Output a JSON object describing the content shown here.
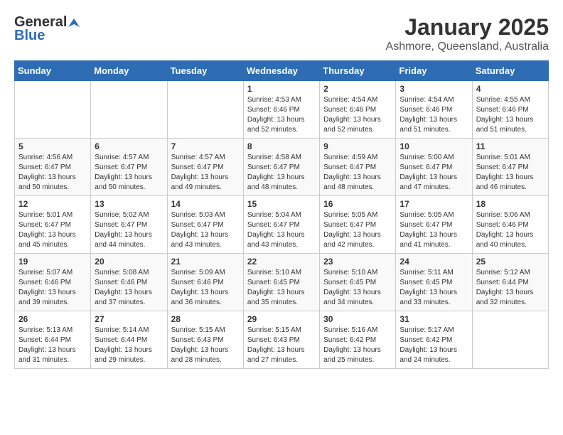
{
  "header": {
    "logo_general": "General",
    "logo_blue": "Blue",
    "title": "January 2025",
    "subtitle": "Ashmore, Queensland, Australia"
  },
  "weekdays": [
    "Sunday",
    "Monday",
    "Tuesday",
    "Wednesday",
    "Thursday",
    "Friday",
    "Saturday"
  ],
  "weeks": [
    [
      {
        "day": "",
        "info": ""
      },
      {
        "day": "",
        "info": ""
      },
      {
        "day": "",
        "info": ""
      },
      {
        "day": "1",
        "info": "Sunrise: 4:53 AM\nSunset: 6:46 PM\nDaylight: 13 hours and 52 minutes."
      },
      {
        "day": "2",
        "info": "Sunrise: 4:54 AM\nSunset: 6:46 PM\nDaylight: 13 hours and 52 minutes."
      },
      {
        "day": "3",
        "info": "Sunrise: 4:54 AM\nSunset: 6:46 PM\nDaylight: 13 hours and 51 minutes."
      },
      {
        "day": "4",
        "info": "Sunrise: 4:55 AM\nSunset: 6:46 PM\nDaylight: 13 hours and 51 minutes."
      }
    ],
    [
      {
        "day": "5",
        "info": "Sunrise: 4:56 AM\nSunset: 6:47 PM\nDaylight: 13 hours and 50 minutes."
      },
      {
        "day": "6",
        "info": "Sunrise: 4:57 AM\nSunset: 6:47 PM\nDaylight: 13 hours and 50 minutes."
      },
      {
        "day": "7",
        "info": "Sunrise: 4:57 AM\nSunset: 6:47 PM\nDaylight: 13 hours and 49 minutes."
      },
      {
        "day": "8",
        "info": "Sunrise: 4:58 AM\nSunset: 6:47 PM\nDaylight: 13 hours and 48 minutes."
      },
      {
        "day": "9",
        "info": "Sunrise: 4:59 AM\nSunset: 6:47 PM\nDaylight: 13 hours and 48 minutes."
      },
      {
        "day": "10",
        "info": "Sunrise: 5:00 AM\nSunset: 6:47 PM\nDaylight: 13 hours and 47 minutes."
      },
      {
        "day": "11",
        "info": "Sunrise: 5:01 AM\nSunset: 6:47 PM\nDaylight: 13 hours and 46 minutes."
      }
    ],
    [
      {
        "day": "12",
        "info": "Sunrise: 5:01 AM\nSunset: 6:47 PM\nDaylight: 13 hours and 45 minutes."
      },
      {
        "day": "13",
        "info": "Sunrise: 5:02 AM\nSunset: 6:47 PM\nDaylight: 13 hours and 44 minutes."
      },
      {
        "day": "14",
        "info": "Sunrise: 5:03 AM\nSunset: 6:47 PM\nDaylight: 13 hours and 43 minutes."
      },
      {
        "day": "15",
        "info": "Sunrise: 5:04 AM\nSunset: 6:47 PM\nDaylight: 13 hours and 43 minutes."
      },
      {
        "day": "16",
        "info": "Sunrise: 5:05 AM\nSunset: 6:47 PM\nDaylight: 13 hours and 42 minutes."
      },
      {
        "day": "17",
        "info": "Sunrise: 5:05 AM\nSunset: 6:47 PM\nDaylight: 13 hours and 41 minutes."
      },
      {
        "day": "18",
        "info": "Sunrise: 5:06 AM\nSunset: 6:46 PM\nDaylight: 13 hours and 40 minutes."
      }
    ],
    [
      {
        "day": "19",
        "info": "Sunrise: 5:07 AM\nSunset: 6:46 PM\nDaylight: 13 hours and 39 minutes."
      },
      {
        "day": "20",
        "info": "Sunrise: 5:08 AM\nSunset: 6:46 PM\nDaylight: 13 hours and 37 minutes."
      },
      {
        "day": "21",
        "info": "Sunrise: 5:09 AM\nSunset: 6:46 PM\nDaylight: 13 hours and 36 minutes."
      },
      {
        "day": "22",
        "info": "Sunrise: 5:10 AM\nSunset: 6:45 PM\nDaylight: 13 hours and 35 minutes."
      },
      {
        "day": "23",
        "info": "Sunrise: 5:10 AM\nSunset: 6:45 PM\nDaylight: 13 hours and 34 minutes."
      },
      {
        "day": "24",
        "info": "Sunrise: 5:11 AM\nSunset: 6:45 PM\nDaylight: 13 hours and 33 minutes."
      },
      {
        "day": "25",
        "info": "Sunrise: 5:12 AM\nSunset: 6:44 PM\nDaylight: 13 hours and 32 minutes."
      }
    ],
    [
      {
        "day": "26",
        "info": "Sunrise: 5:13 AM\nSunset: 6:44 PM\nDaylight: 13 hours and 31 minutes."
      },
      {
        "day": "27",
        "info": "Sunrise: 5:14 AM\nSunset: 6:44 PM\nDaylight: 13 hours and 29 minutes."
      },
      {
        "day": "28",
        "info": "Sunrise: 5:15 AM\nSunset: 6:43 PM\nDaylight: 13 hours and 28 minutes."
      },
      {
        "day": "29",
        "info": "Sunrise: 5:15 AM\nSunset: 6:43 PM\nDaylight: 13 hours and 27 minutes."
      },
      {
        "day": "30",
        "info": "Sunrise: 5:16 AM\nSunset: 6:42 PM\nDaylight: 13 hours and 25 minutes."
      },
      {
        "day": "31",
        "info": "Sunrise: 5:17 AM\nSunset: 6:42 PM\nDaylight: 13 hours and 24 minutes."
      },
      {
        "day": "",
        "info": ""
      }
    ]
  ]
}
